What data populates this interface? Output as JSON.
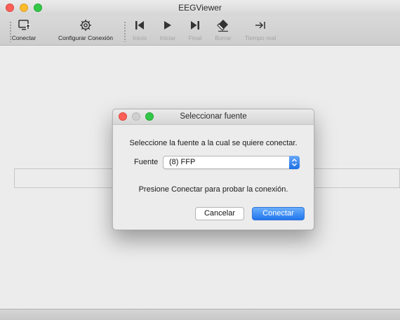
{
  "window": {
    "title": "EEGViewer"
  },
  "toolbar": {
    "items": [
      {
        "label": "Conectar",
        "icon": "connect-monitor-icon",
        "enabled": true
      },
      {
        "label": "Configurar Conexión",
        "icon": "gear-icon",
        "enabled": true
      },
      {
        "label": "Inicio",
        "icon": "skip-to-start-icon",
        "enabled": false
      },
      {
        "label": "Iniciar",
        "icon": "play-icon",
        "enabled": false
      },
      {
        "label": "Final",
        "icon": "skip-to-end-icon",
        "enabled": false
      },
      {
        "label": "Borrar",
        "icon": "eraser-icon",
        "enabled": false
      },
      {
        "label": "Tiempo real",
        "icon": "arrow-to-bar-icon",
        "enabled": false
      }
    ]
  },
  "dialog": {
    "title": "Seleccionar fuente",
    "message": "Seleccione la fuente a la cual se quiere conectar.",
    "source_label": "Fuente",
    "source_value": "(8) FFP",
    "hint": "Presione Conectar para probar la conexión.",
    "cancel_label": "Cancelar",
    "connect_label": "Conectar"
  },
  "colors": {
    "accent": "#2276ed",
    "close": "#fc5f57",
    "minimize": "#fdbc2e",
    "zoom": "#33c748"
  }
}
